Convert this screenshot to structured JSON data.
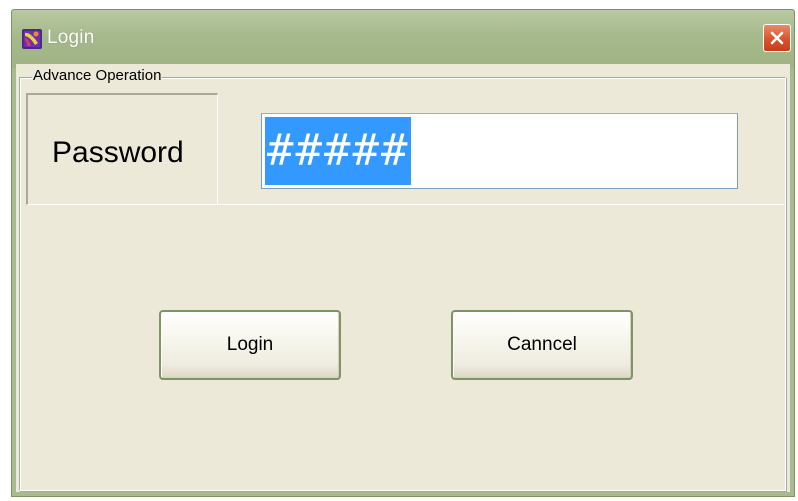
{
  "window": {
    "title": "Login",
    "close_label": "✕"
  },
  "group": {
    "legend": "Advance Operation"
  },
  "password": {
    "label": "Password",
    "value": "#####"
  },
  "buttons": {
    "login_label": "Login",
    "cancel_label": "Canncel"
  },
  "colors": {
    "title_bar": "#a6b98c",
    "client_bg": "#ece9d8",
    "selection": "#3399ff",
    "close_button": "#d8532c",
    "button_border": "#7e9466"
  },
  "icons": {
    "app": "app-logo-icon",
    "close": "close-icon"
  }
}
